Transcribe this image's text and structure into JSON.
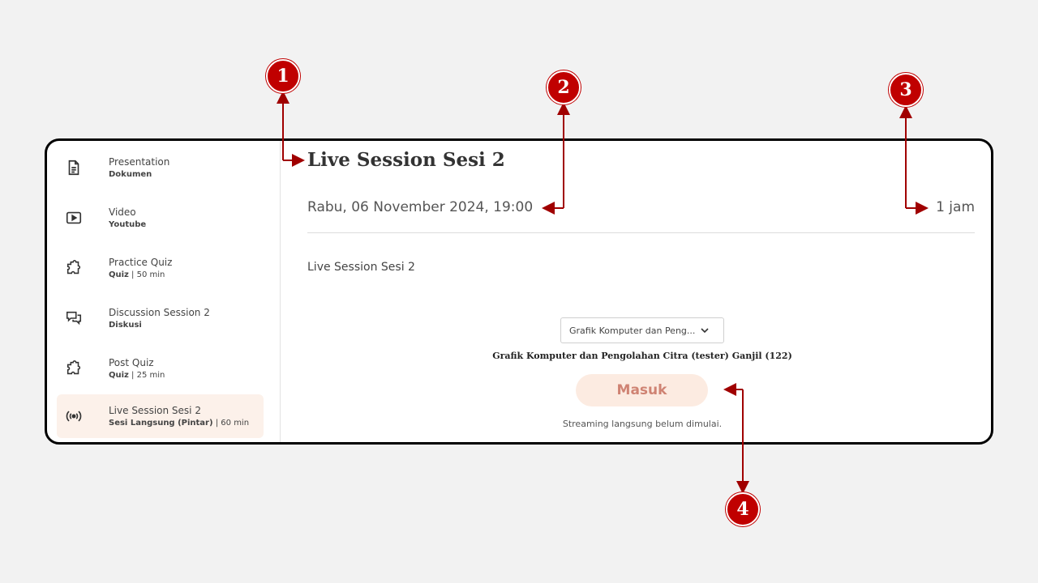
{
  "sidebar": {
    "items": [
      {
        "title": "Presentation",
        "sub_bold": "Dokumen",
        "sub_rest": "",
        "icon": "document-icon"
      },
      {
        "title": "Video",
        "sub_bold": "Youtube",
        "sub_rest": "",
        "icon": "video-play-icon"
      },
      {
        "title": "Practice Quiz",
        "sub_bold": "Quiz",
        "sub_rest": " | 50 min",
        "icon": "puzzle-icon"
      },
      {
        "title": "Discussion Session 2",
        "sub_bold": "Diskusi",
        "sub_rest": "",
        "icon": "chat-bubbles-icon"
      },
      {
        "title": "Post Quiz",
        "sub_bold": "Quiz",
        "sub_rest": " | 25 min",
        "icon": "puzzle-icon"
      },
      {
        "title": "Live Session Sesi 2",
        "sub_bold": "Sesi Langsung (Pintar)",
        "sub_rest": " | 60 min",
        "icon": "broadcast-icon"
      }
    ]
  },
  "session": {
    "title": "Live Session Sesi 2",
    "datetime": "Rabu, 06 November 2024, 19:00",
    "duration": "1 jam",
    "description": "Live Session Sesi 2",
    "class_select": "Grafik Komputer dan Peng...",
    "class_name": "Grafik Komputer dan Pengolahan Citra (tester) Ganjil (122)",
    "join_label": "Masuk",
    "status_text": "Streaming langsung belum dimulai."
  },
  "annotations": {
    "badge_1": "1",
    "badge_2": "2",
    "badge_3": "3",
    "badge_4": "4"
  },
  "colors": {
    "accent": "#c00000",
    "active_bg": "#fcf1ea",
    "button_bg": "#fcebe1",
    "button_text": "#cf8373"
  }
}
